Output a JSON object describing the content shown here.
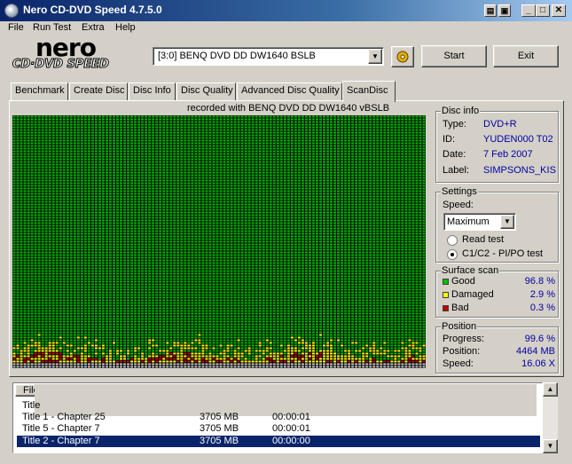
{
  "window": {
    "title": "Nero CD-DVD Speed 4.7.5.0",
    "controls": {
      "minimize": "_",
      "maximize": "□",
      "close": "✕"
    }
  },
  "menu": [
    "File",
    "Run Test",
    "Extra",
    "Help"
  ],
  "logo": {
    "brand": "nero",
    "product": "CD·DVD SPEED"
  },
  "drive_select": {
    "value": "[3:0]   BENQ DVD DD DW1640 BSLB"
  },
  "buttons": {
    "start": "Start",
    "exit": "Exit"
  },
  "tabs": [
    "Benchmark",
    "Create Disc",
    "Disc Info",
    "Disc Quality",
    "Advanced Disc Quality",
    "ScanDisc"
  ],
  "active_tab": "ScanDisc",
  "recorded_with": "recorded with BENQ     DVD DD DW1640     vBSLB",
  "disc_info": {
    "title": "Disc info",
    "type_label": "Type:",
    "type": "DVD+R",
    "id_label": "ID:",
    "id": "YUDEN000 T02",
    "date_label": "Date:",
    "date": "7 Feb 2007",
    "disc_label_label": "Label:",
    "disc_label": "SIMPSONS_KIS:"
  },
  "settings": {
    "title": "Settings",
    "speed_label": "Speed:",
    "speed_value": "Maximum",
    "read_test_label": "Read test",
    "c1c2_label": "C1/C2 - PI/PO test",
    "selected_mode": "C1/C2 - PI/PO test"
  },
  "surface_scan": {
    "title": "Surface scan",
    "good_label": "Good",
    "good": "96.8 %",
    "damaged_label": "Damaged",
    "damaged": "2.9 %",
    "bad_label": "Bad",
    "bad": "0.3 %",
    "colors": {
      "good": "#00c000",
      "damaged": "#ffff00",
      "bad": "#c00000"
    }
  },
  "position": {
    "title": "Position",
    "progress_label": "Progress:",
    "progress": "99.6 %",
    "position_label": "Position:",
    "position": "4464 MB",
    "speed_label": "Speed:",
    "speed": "16.06 X"
  },
  "file_list": {
    "header_file": "File",
    "rows": [
      {
        "name": "Title",
        "size": "",
        "time": "",
        "selected": false
      },
      {
        "name": "Title 1 - Chapter 25",
        "size": "3705 MB",
        "time": "00:00:01",
        "selected": false
      },
      {
        "name": "Title 5 - Chapter 7",
        "size": "3705 MB",
        "time": "00:00:01",
        "selected": false
      },
      {
        "name": "Title 2 - Chapter 7",
        "size": "3705 MB",
        "time": "00:00:00",
        "selected": true
      }
    ]
  }
}
